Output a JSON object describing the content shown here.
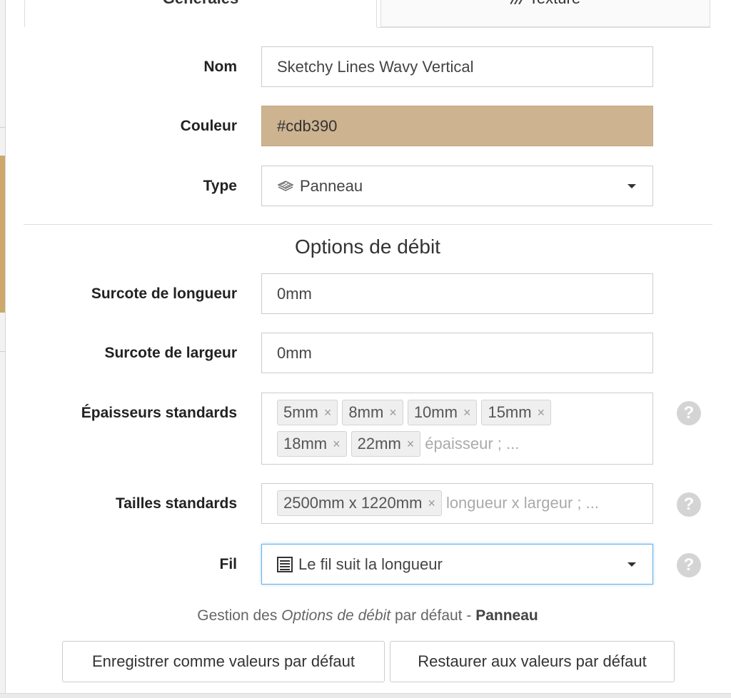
{
  "tabs": [
    {
      "label": "Générales",
      "active": true,
      "icon": ""
    },
    {
      "label": "Texture",
      "active": false,
      "icon": "texture-hatch-icon"
    }
  ],
  "form": {
    "name": {
      "label": "Nom",
      "value": "Sketchy Lines Wavy Vertical"
    },
    "color": {
      "label": "Couleur",
      "value": "#cdb390",
      "swatch": "#cdb390"
    },
    "type": {
      "label": "Type",
      "value": "Panneau",
      "icon": "sheet-material-icon"
    }
  },
  "cutting_options": {
    "title": "Options de débit",
    "length_increase": {
      "label": "Surcote de longueur",
      "value": "0mm"
    },
    "width_increase": {
      "label": "Surcote de largeur",
      "value": "0mm"
    },
    "std_thicknesses": {
      "label": "Épaisseurs standards",
      "tags": [
        "5mm",
        "8mm",
        "10mm",
        "15mm",
        "18mm",
        "22mm"
      ],
      "placeholder": "épaisseur ; ..."
    },
    "std_sizes": {
      "label": "Tailles standards",
      "tags": [
        "2500mm x 1220mm"
      ],
      "placeholder": "longueur x largeur ; ..."
    },
    "grain": {
      "label": "Fil",
      "value": "Le fil suit la longueur",
      "icon": "grain-lines-icon"
    }
  },
  "footer": {
    "note_prefix": "Gestion des ",
    "note_italic": "Options de débit",
    "note_middle": " par défaut - ",
    "note_bold": "Panneau",
    "save_defaults": "Enregistrer comme valeurs par défaut",
    "restore_defaults": "Restaurer aux valeurs par défaut"
  },
  "colors": {
    "accent_focus": "#66afe9",
    "help_icon": "#d4d4d4"
  }
}
